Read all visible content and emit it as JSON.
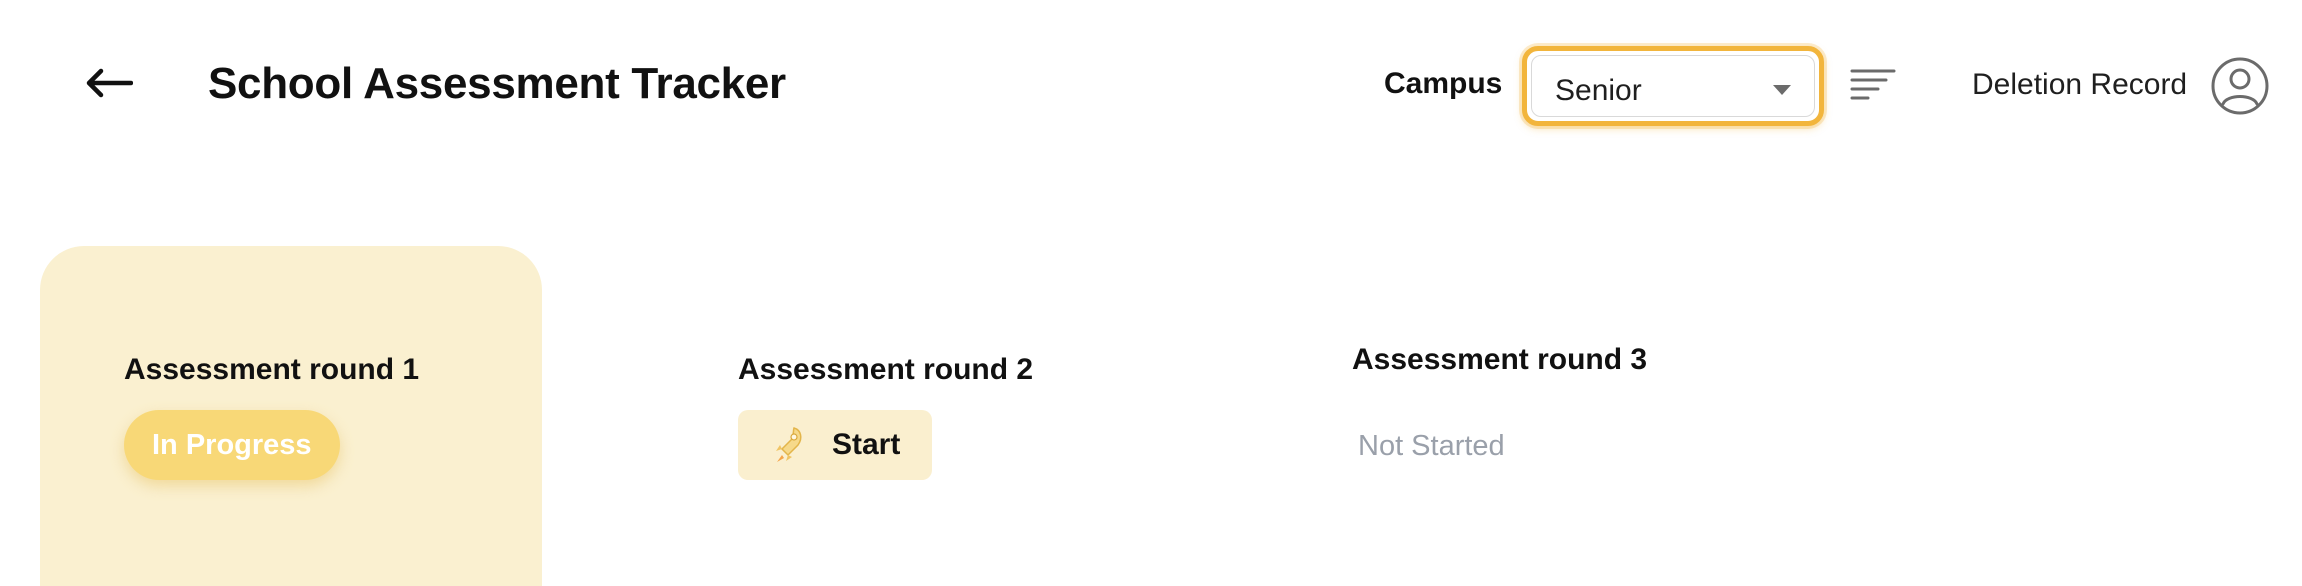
{
  "header": {
    "title": "School Assessment Tracker",
    "back_icon": "arrow-left-icon",
    "campus_label": "Campus",
    "campus_selected": "Senior",
    "deletion_label": "Deletion Record",
    "sort_icon": "sort-lines-icon",
    "avatar_icon": "user-circle-icon"
  },
  "rounds": [
    {
      "title": "Assessment round 1",
      "status": "In Progress"
    },
    {
      "title": "Assessment round 2",
      "action": "Start",
      "action_icon": "rocket-icon"
    },
    {
      "title": "Assessment round 3",
      "status": "Not Started"
    }
  ],
  "colors": {
    "accent": "#f2b53c",
    "card_bg": "#faf0d0",
    "pill_bg": "#f8d877",
    "muted_text": "#9aa0aa"
  }
}
